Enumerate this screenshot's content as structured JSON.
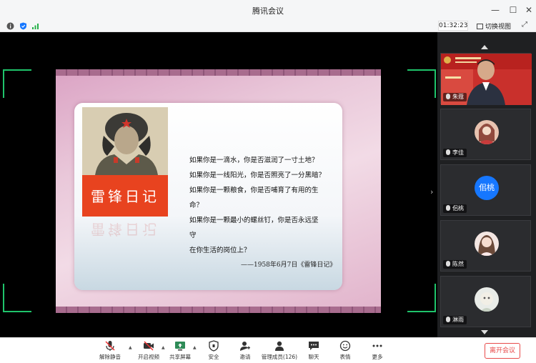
{
  "window": {
    "title": "腾讯会议",
    "controls": [
      "minimize",
      "maximize",
      "close"
    ]
  },
  "status": {
    "timer": "01:32:23",
    "switch_view": "切换视图",
    "icons": [
      "info-icon",
      "shield-icon",
      "signal-icon",
      "expand-icon"
    ]
  },
  "slide": {
    "diary_title": "雷锋日记",
    "lines": [
      "如果你是一滴水，你是否滋润了一寸土地？",
      "如果你是一线阳光，你是否照亮了一分黑暗？",
      "如果你是一颗粮食，你是否哺育了有用的生",
      "命？",
      "如果你是一颗最小的螺丝钉，你是否永远坚",
      "守",
      "在你生活的岗位上？"
    ],
    "attribution": "——1958年6月7日《雷锋日记》"
  },
  "participants": [
    {
      "name": "朱蔻",
      "kind": "video"
    },
    {
      "name": "李佳",
      "kind": "photo"
    },
    {
      "name": "佀桃",
      "kind": "letter",
      "avatar_text": "佀桃",
      "avatar_color": "#1677ff"
    },
    {
      "name": "陈然",
      "kind": "photo"
    },
    {
      "name": "淋雨",
      "kind": "photo"
    }
  ],
  "toolbar": {
    "items": [
      {
        "label": "解除静音",
        "icon": "mic-muted-icon"
      },
      {
        "label": "开启视频",
        "icon": "camera-off-icon"
      },
      {
        "label": "共享屏幕",
        "icon": "share-screen-icon"
      },
      {
        "label": "安全",
        "icon": "shield-icon"
      },
      {
        "label": "邀请",
        "icon": "invite-icon"
      },
      {
        "label": "管理成员(126)",
        "icon": "members-icon"
      },
      {
        "label": "聊天",
        "icon": "chat-icon"
      },
      {
        "label": "表情",
        "icon": "emoji-icon"
      },
      {
        "label": "更多",
        "icon": "more-icon"
      }
    ],
    "leave": "离开会议"
  },
  "colors": {
    "accent_blue": "#1677ff",
    "leave_red": "#e84a4a",
    "frame_green": "#1fc46b"
  }
}
